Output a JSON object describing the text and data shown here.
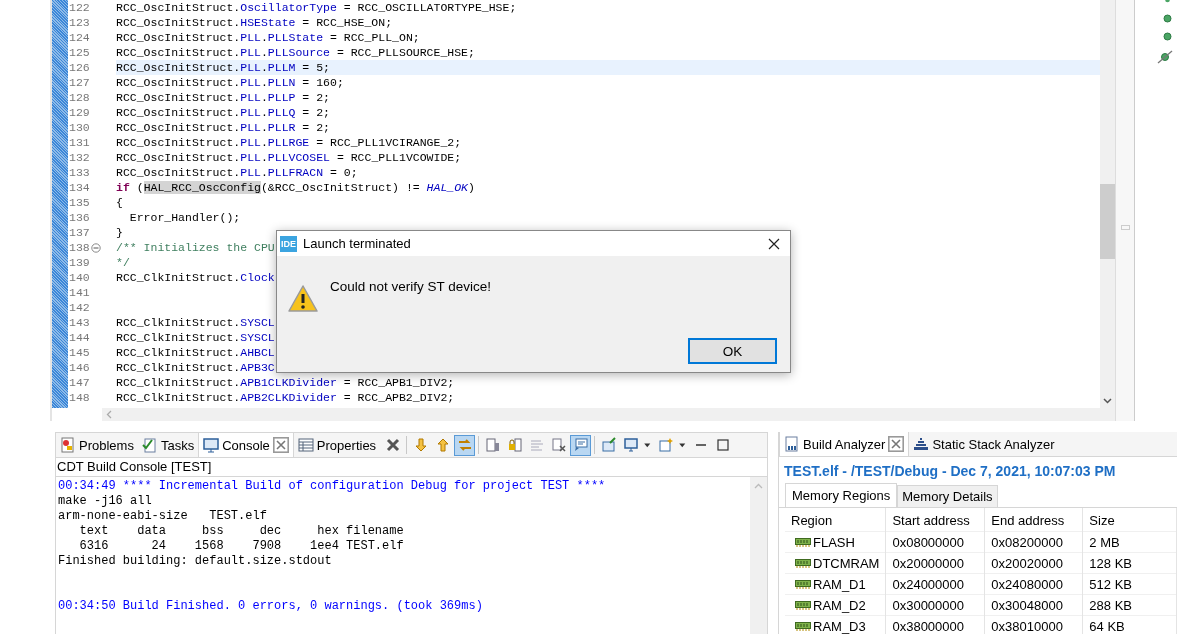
{
  "editor": {
    "lines": [
      {
        "number": "122",
        "current": false,
        "fold": false,
        "segments": [
          {
            "kind": "plain",
            "text": "RCC_OscInitStruct."
          },
          {
            "kind": "field",
            "text": "OscillatorType"
          },
          {
            "kind": "plain",
            "text": " = RCC_OSCILLATORTYPE_HSE;"
          }
        ]
      },
      {
        "number": "123",
        "current": false,
        "fold": false,
        "segments": [
          {
            "kind": "plain",
            "text": "RCC_OscInitStruct."
          },
          {
            "kind": "field",
            "text": "HSEState"
          },
          {
            "kind": "plain",
            "text": " = RCC_HSE_ON;"
          }
        ]
      },
      {
        "number": "124",
        "current": false,
        "fold": false,
        "segments": [
          {
            "kind": "plain",
            "text": "RCC_OscInitStruct."
          },
          {
            "kind": "field",
            "text": "PLL"
          },
          {
            "kind": "plain",
            "text": "."
          },
          {
            "kind": "field",
            "text": "PLLState"
          },
          {
            "kind": "plain",
            "text": " = RCC_PLL_ON;"
          }
        ]
      },
      {
        "number": "125",
        "current": false,
        "fold": false,
        "segments": [
          {
            "kind": "plain",
            "text": "RCC_OscInitStruct."
          },
          {
            "kind": "field",
            "text": "PLL"
          },
          {
            "kind": "plain",
            "text": "."
          },
          {
            "kind": "field",
            "text": "PLLSource"
          },
          {
            "kind": "plain",
            "text": " = RCC_PLLSOURCE_HSE;"
          }
        ]
      },
      {
        "number": "126",
        "current": true,
        "fold": false,
        "segments": [
          {
            "kind": "plain",
            "text": "RCC_OscInitStruct."
          },
          {
            "kind": "field",
            "text": "PLL"
          },
          {
            "kind": "plain",
            "text": "."
          },
          {
            "kind": "field",
            "text": "PLLM"
          },
          {
            "kind": "plain",
            "text": " = 5;"
          }
        ]
      },
      {
        "number": "127",
        "current": false,
        "fold": false,
        "segments": [
          {
            "kind": "plain",
            "text": "RCC_OscInitStruct."
          },
          {
            "kind": "field",
            "text": "PLL"
          },
          {
            "kind": "plain",
            "text": "."
          },
          {
            "kind": "field",
            "text": "PLLN"
          },
          {
            "kind": "plain",
            "text": " = 160;"
          }
        ]
      },
      {
        "number": "128",
        "current": false,
        "fold": false,
        "segments": [
          {
            "kind": "plain",
            "text": "RCC_OscInitStruct."
          },
          {
            "kind": "field",
            "text": "PLL"
          },
          {
            "kind": "plain",
            "text": "."
          },
          {
            "kind": "field",
            "text": "PLLP"
          },
          {
            "kind": "plain",
            "text": " = 2;"
          }
        ]
      },
      {
        "number": "129",
        "current": false,
        "fold": false,
        "segments": [
          {
            "kind": "plain",
            "text": "RCC_OscInitStruct."
          },
          {
            "kind": "field",
            "text": "PLL"
          },
          {
            "kind": "plain",
            "text": "."
          },
          {
            "kind": "field",
            "text": "PLLQ"
          },
          {
            "kind": "plain",
            "text": " = 2;"
          }
        ]
      },
      {
        "number": "130",
        "current": false,
        "fold": false,
        "segments": [
          {
            "kind": "plain",
            "text": "RCC_OscInitStruct."
          },
          {
            "kind": "field",
            "text": "PLL"
          },
          {
            "kind": "plain",
            "text": "."
          },
          {
            "kind": "field",
            "text": "PLLR"
          },
          {
            "kind": "plain",
            "text": " = 2;"
          }
        ]
      },
      {
        "number": "131",
        "current": false,
        "fold": false,
        "segments": [
          {
            "kind": "plain",
            "text": "RCC_OscInitStruct."
          },
          {
            "kind": "field",
            "text": "PLL"
          },
          {
            "kind": "plain",
            "text": "."
          },
          {
            "kind": "field",
            "text": "PLLRGE"
          },
          {
            "kind": "plain",
            "text": " = RCC_PLL1VCIRANGE_2;"
          }
        ]
      },
      {
        "number": "132",
        "current": false,
        "fold": false,
        "segments": [
          {
            "kind": "plain",
            "text": "RCC_OscInitStruct."
          },
          {
            "kind": "field",
            "text": "PLL"
          },
          {
            "kind": "plain",
            "text": "."
          },
          {
            "kind": "field",
            "text": "PLLVCOSEL"
          },
          {
            "kind": "plain",
            "text": " = RCC_PLL1VCOWIDE;"
          }
        ]
      },
      {
        "number": "133",
        "current": false,
        "fold": false,
        "segments": [
          {
            "kind": "plain",
            "text": "RCC_OscInitStruct."
          },
          {
            "kind": "field",
            "text": "PLL"
          },
          {
            "kind": "plain",
            "text": "."
          },
          {
            "kind": "field",
            "text": "PLLFRACN"
          },
          {
            "kind": "plain",
            "text": " = 0;"
          }
        ]
      },
      {
        "number": "134",
        "current": false,
        "fold": false,
        "segments": [
          {
            "kind": "keyword",
            "text": "if"
          },
          {
            "kind": "plain",
            "text": " ("
          },
          {
            "kind": "occurrence",
            "text": "HAL_RCC_OscConfig"
          },
          {
            "kind": "plain",
            "text": "(&RCC_OscInitStruct) != "
          },
          {
            "kind": "macro",
            "text": "HAL_OK"
          },
          {
            "kind": "plain",
            "text": ")"
          }
        ]
      },
      {
        "number": "135",
        "current": false,
        "fold": false,
        "segments": [
          {
            "kind": "plain",
            "text": "{"
          }
        ]
      },
      {
        "number": "136",
        "current": false,
        "fold": false,
        "segments": [
          {
            "kind": "plain",
            "text": "  Error_Handler();"
          }
        ]
      },
      {
        "number": "137",
        "current": false,
        "fold": false,
        "segments": [
          {
            "kind": "plain",
            "text": "}"
          }
        ]
      },
      {
        "number": "138",
        "current": false,
        "fold": true,
        "segments": [
          {
            "kind": "comment",
            "text": "/** Initializes the CPU"
          }
        ]
      },
      {
        "number": "139",
        "current": false,
        "fold": false,
        "segments": [
          {
            "kind": "comment",
            "text": "*/"
          }
        ]
      },
      {
        "number": "140",
        "current": false,
        "fold": false,
        "segments": [
          {
            "kind": "plain",
            "text": "RCC_ClkInitStruct."
          },
          {
            "kind": "field",
            "text": "Clock"
          }
        ]
      },
      {
        "number": "141",
        "current": false,
        "fold": false
      },
      {
        "number": "142",
        "current": false,
        "fold": false
      },
      {
        "number": "143",
        "current": false,
        "fold": false,
        "segments": [
          {
            "kind": "plain",
            "text": "RCC_ClkInitStruct."
          },
          {
            "kind": "field",
            "text": "SYSCL"
          }
        ]
      },
      {
        "number": "144",
        "current": false,
        "fold": false,
        "segments": [
          {
            "kind": "plain",
            "text": "RCC_ClkInitStruct."
          },
          {
            "kind": "field",
            "text": "SYSCL"
          }
        ]
      },
      {
        "number": "145",
        "current": false,
        "fold": false,
        "segments": [
          {
            "kind": "plain",
            "text": "RCC_ClkInitStruct."
          },
          {
            "kind": "field",
            "text": "AHBCL"
          }
        ]
      },
      {
        "number": "146",
        "current": false,
        "fold": false,
        "segments": [
          {
            "kind": "plain",
            "text": "RCC_ClkInitStruct."
          },
          {
            "kind": "field",
            "text": "APB3C"
          }
        ]
      },
      {
        "number": "147",
        "current": false,
        "fold": false,
        "segments": [
          {
            "kind": "plain",
            "text": "RCC_ClkInitStruct."
          },
          {
            "kind": "field",
            "text": "APB1CLKDivider"
          },
          {
            "kind": "plain",
            "text": " = RCC_APB1_DIV2;"
          }
        ]
      },
      {
        "number": "148",
        "current": false,
        "fold": false,
        "segments": [
          {
            "kind": "plain",
            "text": "RCC_ClkInitStruct."
          },
          {
            "kind": "field",
            "text": "APB2CLKDivider"
          },
          {
            "kind": "plain",
            "text": " = RCC_APB2_DIV2;"
          }
        ]
      }
    ]
  },
  "console_panel": {
    "tabs": [
      {
        "label": "Problems",
        "kind": "problems",
        "selected": false
      },
      {
        "label": "Tasks",
        "kind": "tasks",
        "selected": false
      },
      {
        "label": "Console",
        "kind": "console",
        "selected": true
      },
      {
        "label": "Properties",
        "kind": "properties",
        "selected": false
      }
    ],
    "toolbar": [
      {
        "kind": "remove",
        "on": false
      },
      {
        "kind": "separator"
      },
      {
        "kind": "down",
        "on": false
      },
      {
        "kind": "up",
        "on": false
      },
      {
        "kind": "link",
        "on": true
      },
      {
        "kind": "separator"
      },
      {
        "kind": "doc",
        "on": false
      },
      {
        "kind": "lockdoc",
        "on": false
      },
      {
        "kind": "lines",
        "on": false
      },
      {
        "kind": "clear",
        "on": false
      },
      {
        "kind": "display",
        "on": true
      },
      {
        "kind": "separator"
      },
      {
        "kind": "pin",
        "on": false
      },
      {
        "kind": "monitor",
        "on": false
      },
      {
        "kind": "caret",
        "on": false
      },
      {
        "kind": "newdoc",
        "on": false
      },
      {
        "kind": "caret",
        "on": false
      },
      {
        "kind": "minimize",
        "on": false
      },
      {
        "kind": "maximize",
        "on": false
      }
    ],
    "title": "CDT Build Console [TEST]",
    "lines": [
      {
        "kind": "info",
        "text": "00:34:49 **** Incremental Build of configuration Debug for project TEST ****"
      },
      {
        "kind": "output",
        "text": "make -j16 all"
      },
      {
        "kind": "output",
        "text": "arm-none-eabi-size   TEST.elf"
      },
      {
        "kind": "output",
        "text": "   text\t   data\t    bss\t    dec\t    hex\tfilename"
      },
      {
        "kind": "output",
        "text": "   6316\t     24\t   1568\t   7908\t   1ee4\tTEST.elf"
      },
      {
        "kind": "output",
        "text": "Finished building: default.size.stdout"
      },
      {
        "kind": "blank"
      },
      {
        "kind": "blank"
      },
      {
        "kind": "info",
        "text": "00:34:50 Build Finished. 0 errors, 0 warnings. (took 369ms)"
      }
    ]
  },
  "analyzer_panel": {
    "tabs": [
      {
        "label": "Build Analyzer",
        "kind": "build",
        "selected": true
      },
      {
        "label": "Static Stack Analyzer",
        "kind": "stack",
        "selected": false
      }
    ],
    "title": "TEST.elf - /TEST/Debug - Dec 7, 2021, 10:07:03 PM",
    "subtabs": [
      {
        "label": "Memory Regions",
        "selected": true
      },
      {
        "label": "Memory Details",
        "selected": false
      }
    ],
    "columns": [
      "Region",
      "Start address",
      "End address",
      "Size"
    ],
    "rows": [
      {
        "region": "FLASH",
        "start": "0x08000000",
        "end": "0x08200000",
        "size": "2 MB"
      },
      {
        "region": "DTCMRAM",
        "start": "0x20000000",
        "end": "0x20020000",
        "size": "128 KB"
      },
      {
        "region": "RAM_D1",
        "start": "0x24000000",
        "end": "0x24080000",
        "size": "512 KB"
      },
      {
        "region": "RAM_D2",
        "start": "0x30000000",
        "end": "0x30048000",
        "size": "288 KB"
      },
      {
        "region": "RAM_D3",
        "start": "0x38000000",
        "end": "0x38010000",
        "size": "64 KB"
      }
    ]
  },
  "dialog": {
    "title": "Launch terminated",
    "app_badge": "IDE",
    "message": "Could not verify ST device!",
    "buttons": [
      {
        "label": "OK",
        "selected": true
      }
    ]
  }
}
